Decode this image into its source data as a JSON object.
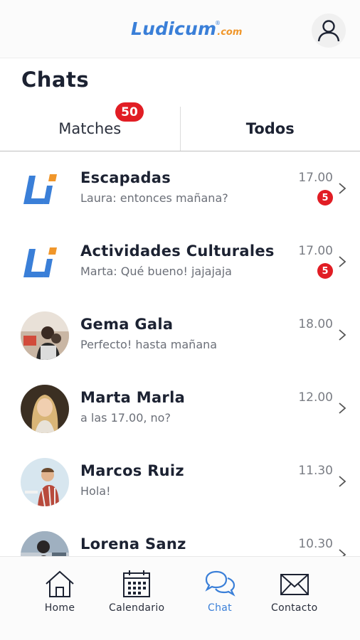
{
  "header": {
    "logo_text": "Ludicum",
    "logo_suffix": ".com",
    "logo_registered": "®",
    "profile_icon": "user-icon"
  },
  "page": {
    "title": "Chats"
  },
  "tabs": [
    {
      "label": "Matches",
      "badge": "50",
      "active": false
    },
    {
      "label": "Todos",
      "active": true
    }
  ],
  "chats": [
    {
      "name": "Escapadas",
      "preview": "Laura: entonces mañana?",
      "time": "17.00",
      "unread": "5",
      "avatar": "ludicum-logo"
    },
    {
      "name": "Actividades Culturales",
      "preview": "Marta: Qué bueno! jajajaja",
      "time": "17.00",
      "unread": "5",
      "avatar": "ludicum-logo"
    },
    {
      "name": "Gema Gala",
      "preview": "Perfecto! hasta mañana",
      "time": "18.00",
      "avatar": "photo"
    },
    {
      "name": "Marta Marla",
      "preview": "a las 17.00, no?",
      "time": "12.00",
      "avatar": "photo"
    },
    {
      "name": "Marcos Ruiz",
      "preview": "Hola!",
      "time": "11.30",
      "avatar": "photo"
    },
    {
      "name": "Lorena Sanz",
      "preview": "",
      "time": "10.30",
      "avatar": "photo"
    }
  ],
  "nav": [
    {
      "label": "Home",
      "icon": "home-icon",
      "active": false
    },
    {
      "label": "Calendario",
      "icon": "calendar-icon",
      "active": false
    },
    {
      "label": "Chat",
      "icon": "chat-icon",
      "active": true
    },
    {
      "label": "Contacto",
      "icon": "envelope-icon",
      "active": false
    }
  ],
  "colors": {
    "accent": "#3a7fd8",
    "badge": "#e11d24",
    "logo_orange": "#f0962a"
  }
}
